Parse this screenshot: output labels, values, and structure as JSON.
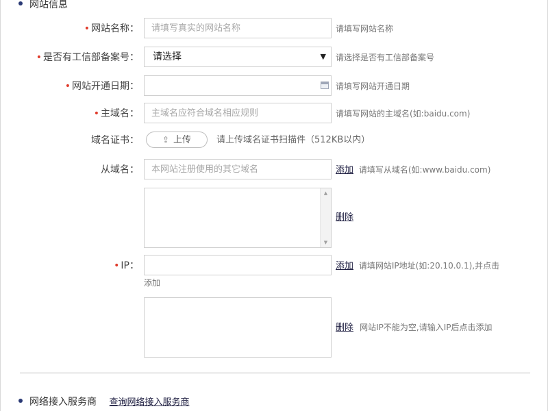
{
  "section1": {
    "title": "网站信息"
  },
  "form": {
    "site_name": {
      "label": "网站名称：",
      "required": "•",
      "placeholder": "请填写真实的网站名称",
      "hint": "请填写网站名称"
    },
    "icp": {
      "label": "是否有工信部备案号：",
      "required": "•",
      "selected": "请选择",
      "hint": "请选择是否有工信部备案号"
    },
    "open_date": {
      "label": "网站开通日期：",
      "required": "•",
      "value": "",
      "hint": "请填写网站开通日期"
    },
    "main_domain": {
      "label": "主域名：",
      "required": "•",
      "placeholder": "主域名应符合域名相应规则",
      "hint": "请填写网站的主域名(如:baidu.com)"
    },
    "cert": {
      "label": "域名证书：",
      "button": "上传",
      "hint": "请上传域名证书扫描件（512KB以内）"
    },
    "sub_domain": {
      "label": "从域名：",
      "placeholder": "本网站注册使用的其它域名",
      "add": "添加",
      "hint": "请填写从域名(如:www.baidu.com)",
      "delete": "删除"
    },
    "ip": {
      "label": "IP：",
      "required": "•",
      "value": "",
      "add": "添加",
      "hint": "请填网站IP地址(如:20.10.0.1),并点击",
      "hint2": "添加",
      "delete": "删除",
      "delete_hint": "网站IP不能为空,请输入IP后点击添加"
    }
  },
  "section2": {
    "title": "网络接入服务商",
    "link": "查询网络接入服务商"
  },
  "colors": {
    "required": "#e03b2b",
    "bullet": "#2b3a75",
    "border": "#cfcfcf"
  },
  "icons": {
    "dropdown": "triangle-down-icon",
    "calendar": "calendar-icon",
    "upload": "upload-icon"
  }
}
